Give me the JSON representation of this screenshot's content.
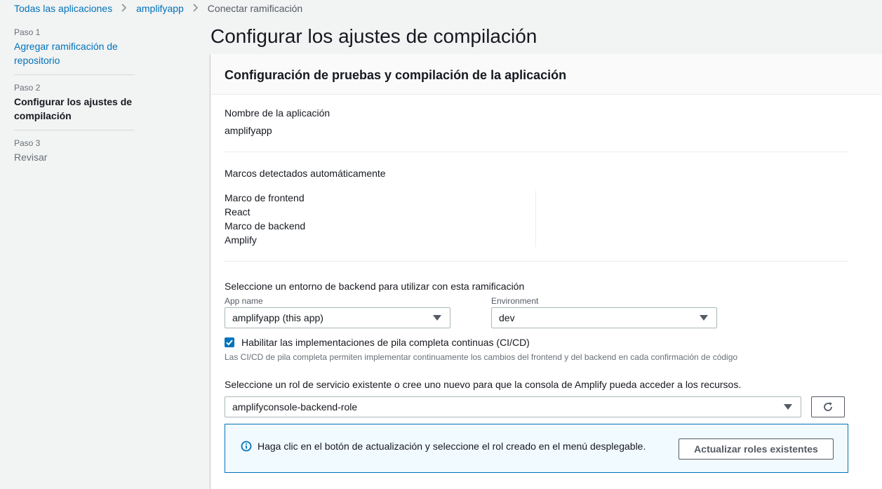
{
  "breadcrumb": {
    "items": [
      "Todas las aplicaciones",
      "amplifyapp"
    ],
    "current": "Conectar ramificación"
  },
  "steps": [
    {
      "num": "Paso 1",
      "title": "Agregar ramificación de repositorio",
      "state": "link"
    },
    {
      "num": "Paso 2",
      "title": "Configurar los ajustes de compilación",
      "state": "active"
    },
    {
      "num": "Paso 3",
      "title": "Revisar",
      "state": "disabled"
    }
  ],
  "page_title": "Configurar los ajustes de compilación",
  "panel": {
    "title": "Configuración de pruebas y compilación de la aplicación",
    "app_name_label": "Nombre de la aplicación",
    "app_name_value": "amplifyapp",
    "frameworks_label": "Marcos detectados automáticamente",
    "frontend_label": "Marco de frontend",
    "frontend_value": "React",
    "backend_label": "Marco de backend",
    "backend_value": "Amplify",
    "backend_env_label": "Seleccione un entorno de backend para utilizar con esta ramificación",
    "app_select_label": "App name",
    "app_select_value": "amplifyapp (this app)",
    "env_select_label": "Environment",
    "env_select_value": "dev",
    "cicd_label": "Habilitar las implementaciones de pila completa continuas (CI/CD)",
    "cicd_checked": true,
    "cicd_desc": "Las CI/CD de pila completa permiten implementar continuamente los cambios del frontend y del backend en cada confirmación de código",
    "role_label": "Seleccione un rol de servicio existente o cree uno nuevo para que la consola de Amplify pueda acceder a los recursos.",
    "role_value": "amplifyconsole-backend-role",
    "info_text": "Haga clic en el botón de actualización y seleccione el rol creado en el menú desplegable.",
    "refresh_roles_button": "Actualizar roles existentes"
  },
  "colors": {
    "link": "#0073bb",
    "info_bg": "#f1faff",
    "info_border": "#0073bb",
    "page_bg": "#f2f3f3"
  },
  "icons": {
    "breadcrumb_separator": "chevron-right-icon",
    "select_caret": "caret-down-icon",
    "refresh": "refresh-icon",
    "info": "info-icon",
    "checkbox": "check-icon"
  }
}
